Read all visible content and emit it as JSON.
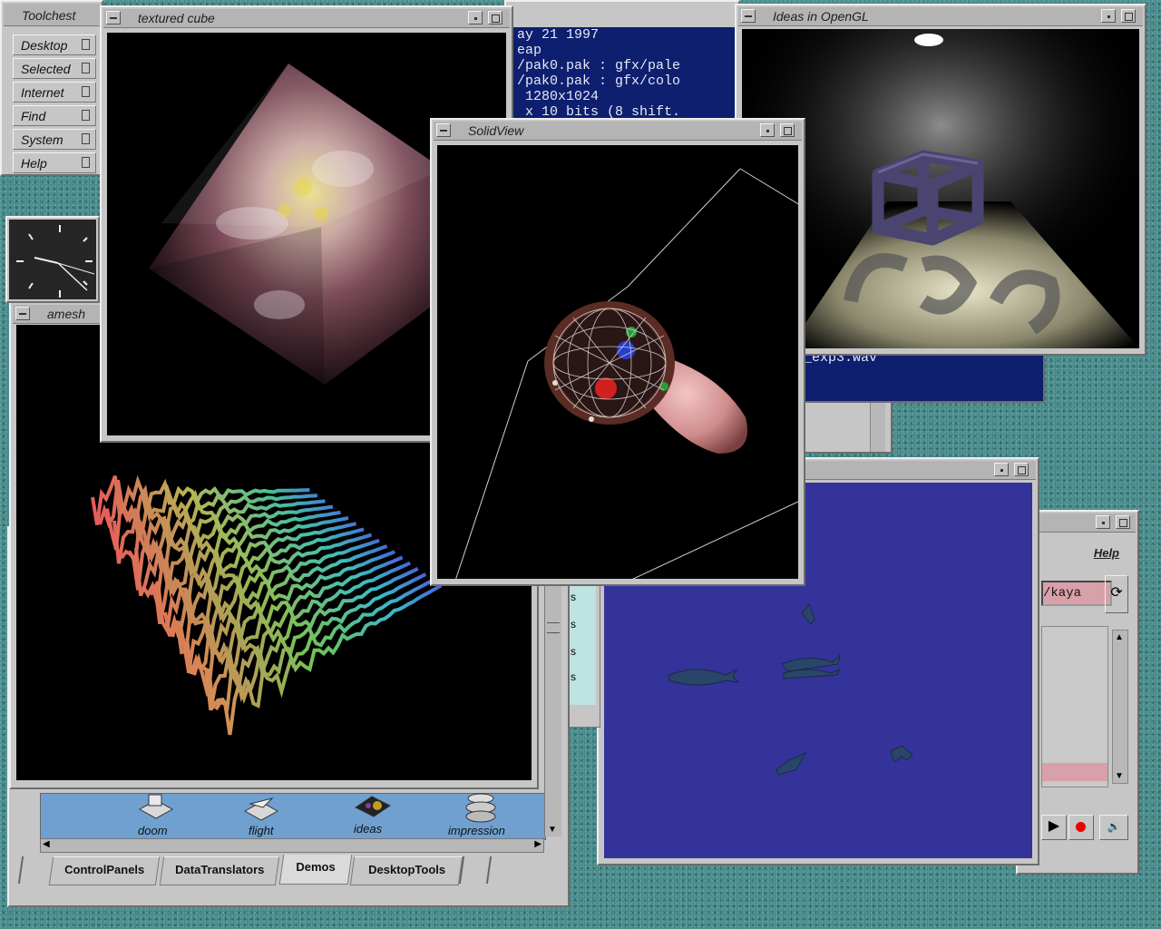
{
  "toolchest": {
    "title": "Toolchest",
    "items": [
      "Desktop",
      "Selected",
      "Internet",
      "Find",
      "System",
      "Help"
    ]
  },
  "textured_cube": {
    "title": "textured cube"
  },
  "amesh": {
    "title": "amesh"
  },
  "solidview": {
    "title": "SolidView"
  },
  "ideas": {
    "title": "Ideas in OpenGL"
  },
  "console": {
    "lines": [
      "ay 21 1997",
      "eap",
      "/pak0.pak : gfx/pale",
      "/pak0.pak : gfx/colo",
      " 1280x1024",
      " x 10 bits (8 shift."
    ]
  },
  "console2": {
    "line": "_exp3.wav"
  },
  "file_manager": {
    "icons": [
      "doom",
      "flight",
      "ideas",
      "impression"
    ],
    "tabs": [
      "ControlPanels",
      "DataTranslators",
      "Demos",
      "DesktopTools"
    ],
    "active_tab": "Demos"
  },
  "partial_list": {
    "marks": [
      "s",
      "s",
      "s",
      "s"
    ]
  },
  "media_panel": {
    "help_label": "Help",
    "path_value": "/kaya"
  },
  "colors": {
    "desktop": "#3f7f7f",
    "window_gray": "#c6c6c6",
    "terminal_blue": "#0d1f6e",
    "fish_bg": "#33339a"
  }
}
